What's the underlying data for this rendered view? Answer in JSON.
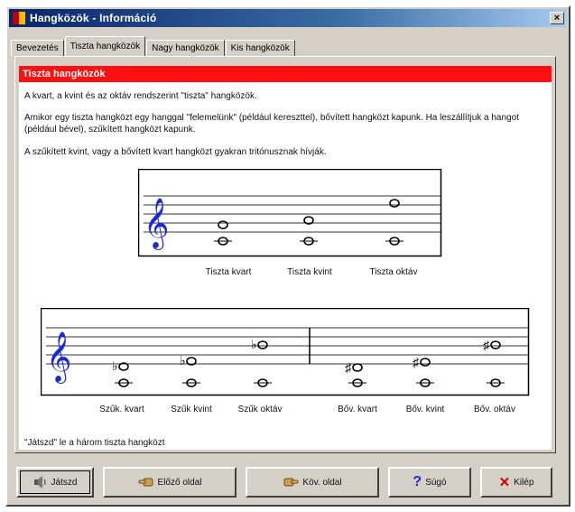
{
  "window": {
    "title": "Hangközök - Információ",
    "close_glyph": "×"
  },
  "tabs": [
    {
      "label": "Bevezetés",
      "active": false
    },
    {
      "label": "Tiszta hangközök",
      "active": true
    },
    {
      "label": "Nagy hangközök",
      "active": false
    },
    {
      "label": "Kis hangközök",
      "active": false
    }
  ],
  "content": {
    "heading": "Tiszta hangközök",
    "para1": "A kvart, a kvint és az oktáv rendszerint \"tiszta\" hangközök.",
    "para2": "Amikor egy tiszta hangközt egy hanggal \"felemelünk\" (például kereszttel), bővített hangközt kapunk. Ha leszállítjuk a hangot (például bével), szűkített hangközt kapunk.",
    "para3": "A szűkített kvint, vagy a bővített kvart hangközt gyakran tritónusznak hívják.",
    "staff1": {
      "captions": [
        "Tiszta kvart",
        "Tiszta kvint",
        "Tiszta oktáv"
      ]
    },
    "staff2": {
      "captions": [
        "Szűk. kvart",
        "Szűk kvint",
        "Szűk oktáv",
        "Bőv. kvart",
        "Bőv. kvint",
        "Bőv. oktáv"
      ],
      "accidentals": [
        "♭",
        "♭",
        "♭",
        "♯",
        "♯",
        "♯"
      ]
    },
    "play_hint": "\"Játszd\" le a három tiszta hangközt"
  },
  "buttons": {
    "play": "Játszd",
    "prev": "Előző oldal",
    "next": "Köv. oldal",
    "help": "Súgó",
    "exit": "Kilép"
  },
  "icons": {
    "play": "speaker-icon",
    "prev": "hand-left-icon",
    "next": "hand-right-icon",
    "help": "question-icon",
    "exit": "x-icon"
  },
  "colors": {
    "title_bar": "#0a246a",
    "heading_bar": "#ff1010",
    "clef": "#1a2ad8"
  }
}
